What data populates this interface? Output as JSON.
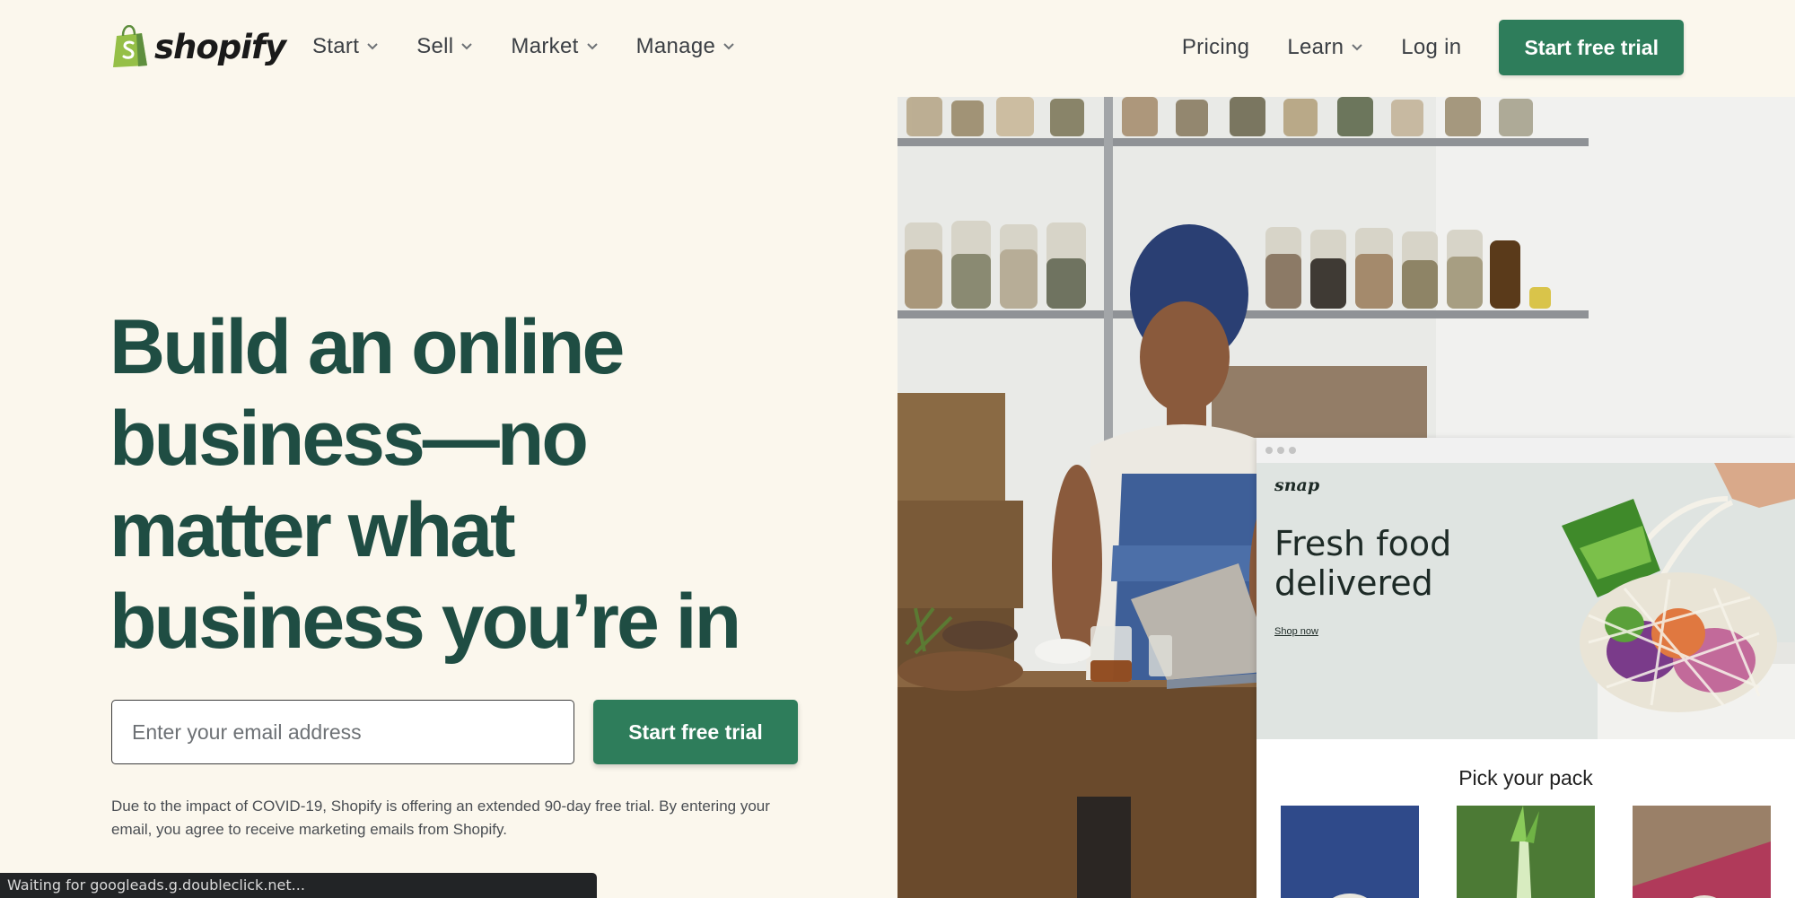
{
  "header": {
    "logo_text": "shopify",
    "nav_left": [
      {
        "label": "Start",
        "has_dropdown": true
      },
      {
        "label": "Sell",
        "has_dropdown": true
      },
      {
        "label": "Market",
        "has_dropdown": true
      },
      {
        "label": "Manage",
        "has_dropdown": true
      }
    ],
    "pricing_label": "Pricing",
    "learn_label": "Learn",
    "login_label": "Log in",
    "cta_label": "Start free trial"
  },
  "hero": {
    "headline_lines": [
      "Build an online",
      "business—no",
      "matter what",
      "business you’re in"
    ],
    "email_placeholder": "Enter your email address",
    "email_value": "",
    "cta_label": "Start free trial",
    "disclaimer": "Due to the impact of COVID-19, Shopify is offering an extended 90-day free trial. By entering your email, you agree to receive marketing emails from Shopify."
  },
  "mockup": {
    "brand": "snap",
    "headline": "Fresh food delivered",
    "link_label": "Shop now",
    "section_title": "Pick your pack"
  },
  "status_bar": {
    "text": "Waiting for googleads.g.doubleclick.net..."
  },
  "colors": {
    "page_background": "#fbf7ed",
    "brand_green": "#2e7d5b",
    "headline_green": "#1f4d43",
    "logo_green": "#95bf47"
  }
}
